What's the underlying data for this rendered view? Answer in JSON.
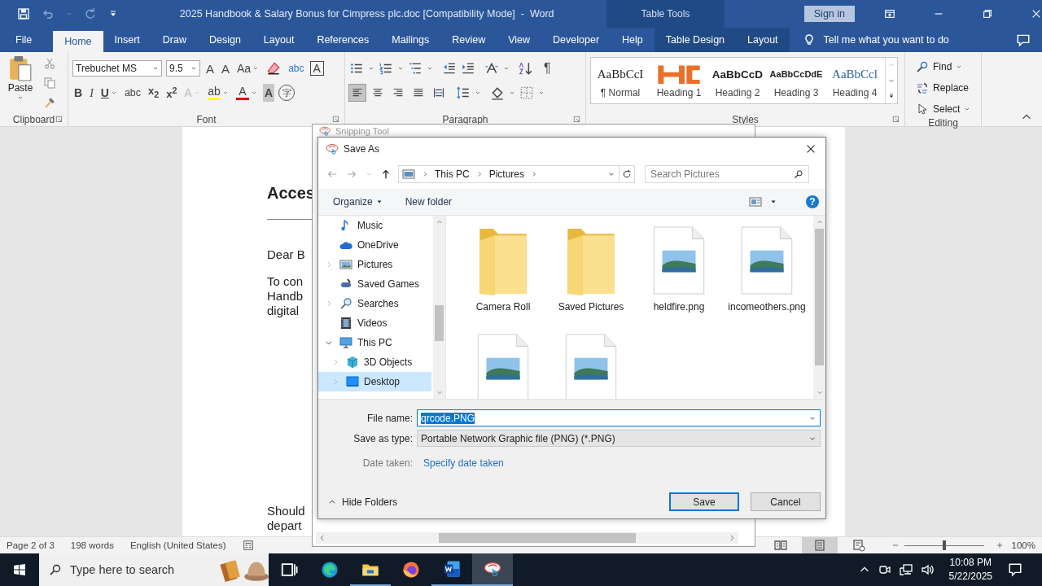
{
  "title_bar": {
    "title": "2025 Handbook & Salary Bonus for Cimpress plc.doc [Compatibility Mode]  -  Word",
    "context": "Table Tools",
    "sign_in": "Sign in"
  },
  "tabs": [
    {
      "label": "File",
      "selected": false,
      "kind": "plain"
    },
    {
      "label": "Home",
      "selected": true,
      "kind": "plain"
    },
    {
      "label": "Insert",
      "selected": false,
      "kind": "plain"
    },
    {
      "label": "Draw",
      "selected": false,
      "kind": "plain"
    },
    {
      "label": "Design",
      "selected": false,
      "kind": "plain"
    },
    {
      "label": "Layout",
      "selected": false,
      "kind": "plain"
    },
    {
      "label": "References",
      "selected": false,
      "kind": "plain"
    },
    {
      "label": "Mailings",
      "selected": false,
      "kind": "plain"
    },
    {
      "label": "Review",
      "selected": false,
      "kind": "plain"
    },
    {
      "label": "View",
      "selected": false,
      "kind": "plain"
    },
    {
      "label": "Developer",
      "selected": false,
      "kind": "plain"
    },
    {
      "label": "Help",
      "selected": false,
      "kind": "plain"
    },
    {
      "label": "Table Design",
      "selected": false,
      "kind": "context"
    },
    {
      "label": "Layout",
      "selected": false,
      "kind": "context"
    }
  ],
  "tell_me": "Tell me what you want to do",
  "ribbon": {
    "clipboard": {
      "paste": "Paste",
      "label": "Clipboard"
    },
    "font": {
      "name": "Trebuchet MS",
      "size": "9.5",
      "label": "Font",
      "row1": [
        {
          "label": "A",
          "kind": "grow"
        },
        {
          "label": "A",
          "kind": "shrink"
        },
        {
          "label": "Aa",
          "kind": "case"
        },
        {
          "kind": "clear"
        },
        {
          "label": "abc",
          "kind": "phonetic"
        },
        {
          "label": "A",
          "kind": "box"
        }
      ],
      "row2": [
        {
          "label": "B",
          "kind": "bold"
        },
        {
          "label": "I",
          "kind": "italic"
        },
        {
          "label": "U",
          "kind": "underline"
        },
        {
          "label": "abc",
          "kind": "strike"
        },
        {
          "label": "x$_{2}$",
          "kind": "sub"
        },
        {
          "label": "x$^{2}$",
          "kind": "sup"
        },
        {
          "label": "A",
          "kind": "effects"
        },
        {
          "label": "ab",
          "kind": "highlight",
          "color": "#ffff00"
        },
        {
          "label": "A",
          "kind": "color",
          "color": "#e00000"
        },
        {
          "label": "A",
          "kind": "shade"
        },
        {
          "label": "字",
          "kind": "circle"
        }
      ]
    },
    "paragraph": {
      "label": "Paragraph",
      "marks": "¶",
      "alignments": [
        {
          "selected": true
        },
        {
          "selected": false
        },
        {
          "selected": false
        },
        {
          "selected": false
        },
        {
          "selected": false
        }
      ]
    },
    "styles": {
      "label": "Styles",
      "items": [
        {
          "preview": "AaBbCcI",
          "name": "¶ Normal",
          "kind": "normal"
        },
        {
          "name": "Heading 1",
          "kind": "heading1"
        },
        {
          "preview": "AaBbCcD",
          "name": "Heading 2",
          "kind": "heading2"
        },
        {
          "preview": "AaBbCcDdE",
          "name": "Heading 3",
          "kind": "heading3"
        },
        {
          "preview": "AaBbCcl",
          "name": "Heading 4",
          "kind": "heading4"
        }
      ]
    },
    "editing": {
      "label": "Editing",
      "find": "Find",
      "replace": "Replace",
      "select": "Select"
    }
  },
  "document": {
    "heading": "Acces",
    "greeting": "Dear B",
    "lines": [
      "To con",
      "Handb",
      "digital"
    ],
    "bottom_lines": [
      "Should",
      "depart"
    ]
  },
  "snipping_tool": {
    "title": "Snipping Tool"
  },
  "save_as": {
    "title": "Save As",
    "breadcrumb": [
      "This PC",
      "Pictures"
    ],
    "search_placeholder": "Search Pictures",
    "organize": "Organize",
    "new_folder": "New folder",
    "help": "?",
    "nav": [
      {
        "label": "Music",
        "kind": "music",
        "selected": false
      },
      {
        "label": "OneDrive",
        "kind": "cloud",
        "selected": false
      },
      {
        "label": "Pictures",
        "kind": "pictures",
        "selected": false,
        "expanded": false
      },
      {
        "label": "Saved Games",
        "kind": "games",
        "selected": false
      },
      {
        "label": "Searches",
        "kind": "search",
        "selected": false,
        "expanded": false
      },
      {
        "label": "Videos",
        "kind": "videos",
        "selected": false
      },
      {
        "label": "This PC",
        "kind": "pc",
        "selected": false,
        "expanded": true,
        "children": [
          {
            "label": "3D Objects",
            "kind": "cube",
            "selected": false,
            "expanded": false
          },
          {
            "label": "Desktop",
            "kind": "desktop",
            "selected": true,
            "expanded": false
          }
        ]
      }
    ],
    "files": [
      {
        "name": "Camera Roll",
        "kind": "folder"
      },
      {
        "name": "Saved Pictures",
        "kind": "folder"
      },
      {
        "name": "heldfire.png",
        "kind": "image"
      },
      {
        "name": "incomeothers.png",
        "kind": "image"
      },
      {
        "kind": "image"
      },
      {
        "kind": "image"
      }
    ],
    "file_name": {
      "label": "File name:",
      "value": "qrcode.PNG",
      "text_selected": true
    },
    "save_type": {
      "label": "Save as type:",
      "value": "Portable Network Graphic file (PNG) (*.PNG)"
    },
    "date_taken": {
      "label": "Date taken:",
      "link": "Specify date taken"
    },
    "hide_folders": "Hide Folders",
    "save": "Save",
    "cancel": "Cancel"
  },
  "status_bar": {
    "page": "Page 2 of 3",
    "words": "198 words",
    "language": "English (United States)",
    "views": [
      {
        "kind": "read",
        "selected": false
      },
      {
        "kind": "print",
        "selected": true
      },
      {
        "kind": "web",
        "selected": false
      }
    ],
    "zoom": {
      "level": 0.5,
      "reading": "100%"
    }
  },
  "taskbar": {
    "search_placeholder": "Type here to search",
    "apps": [
      {
        "kind": "taskview",
        "selected": false,
        "running": false
      },
      {
        "kind": "edge",
        "selected": false,
        "running": false
      },
      {
        "kind": "explorer",
        "selected": false,
        "running": true
      },
      {
        "kind": "firefox",
        "selected": false,
        "running": false
      },
      {
        "kind": "word",
        "selected": false,
        "running": true
      },
      {
        "kind": "snipping",
        "selected": true,
        "running": true
      }
    ],
    "time": "10:08 PM",
    "date": "5/22/2025"
  }
}
